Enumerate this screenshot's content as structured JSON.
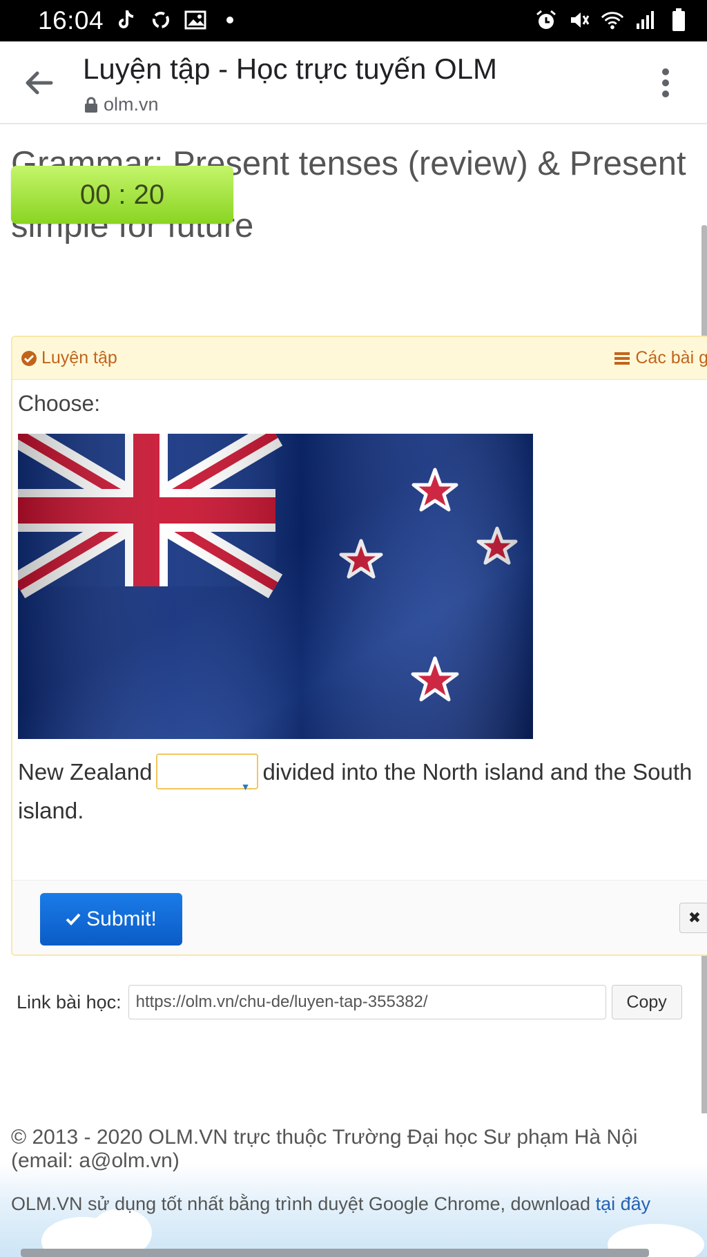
{
  "status_bar": {
    "time": "16:04",
    "left_icons": [
      "tiktok-icon",
      "sync-icon",
      "image-icon",
      "dot-icon"
    ],
    "right_icons": [
      "alarm-icon",
      "mute-icon",
      "wifi-icon",
      "signal-icon",
      "battery-icon"
    ]
  },
  "browser": {
    "title": "Luyện tập - Học trực tuyến OLM",
    "url": "olm.vn"
  },
  "page": {
    "heading_line1": "Grammar: Present tenses (review) & Present",
    "heading_line2": "simple for future",
    "timer": "00 : 20"
  },
  "panel": {
    "header_left": "Luyện tập",
    "header_right": "Các bài g",
    "prompt": "Choose:",
    "sentence_before": "New Zealand",
    "sentence_after": "divided into the North island and the South island.",
    "dropdown_value": "",
    "submit_label": "Submit!",
    "close_label": "✖"
  },
  "link_row": {
    "label": "Link bài học:",
    "url": "https://olm.vn/chu-de/luyen-tap-355382/",
    "copy_label": "Copy"
  },
  "footer": {
    "copyright": "© 2013 - 2020 OLM.VN trực thuộc Trường Đại học Sư phạm Hà Nội (email: a@olm.vn)",
    "chrome_note": "OLM.VN sử dụng tốt nhất bằng trình duyệt Google Chrome, download",
    "chrome_link": "tại đây"
  },
  "colors": {
    "timer_green": "#8ad422",
    "panel_border": "#fbe8a6",
    "panel_header": "#fff8d8",
    "header_text": "#c1641b",
    "submit_blue": "#0b5cc6",
    "flag_blue": "#0c2a78",
    "flag_red": "#c8102e"
  }
}
